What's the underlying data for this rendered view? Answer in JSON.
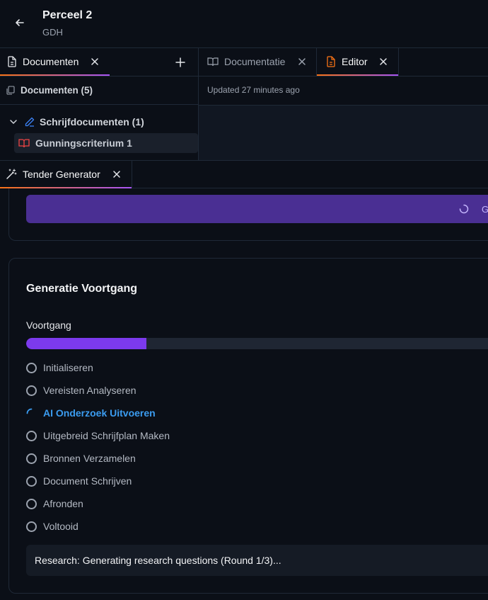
{
  "header": {
    "title": "Perceel 2",
    "subtitle": "GDH"
  },
  "tabs": {
    "documenten": "Documenten",
    "documentatie": "Documentatie",
    "editor": "Editor"
  },
  "documents": {
    "header": "Documenten (5)",
    "group": "Schrijfdocumenten (1)",
    "item": "Gunningscriterium 1"
  },
  "editor": {
    "updated": "Updated 27 minutes ago"
  },
  "generator": {
    "tab_label": "Tender Generator",
    "button_label": "G",
    "progress_title": "Generatie Voortgang",
    "progress_label": "Voortgang",
    "progress_fraction": 0.25,
    "steps": [
      {
        "label": "Initialiseren",
        "state": "pending"
      },
      {
        "label": "Vereisten Analyseren",
        "state": "pending"
      },
      {
        "label": "AI Onderzoek Uitvoeren",
        "state": "active"
      },
      {
        "label": "Uitgebreid Schrijfplan Maken",
        "state": "pending"
      },
      {
        "label": "Bronnen Verzamelen",
        "state": "pending"
      },
      {
        "label": "Document Schrijven",
        "state": "pending"
      },
      {
        "label": "Afronden",
        "state": "pending"
      },
      {
        "label": "Voltooid",
        "state": "pending"
      }
    ],
    "status": "Research: Generating research questions (Round 1/3)..."
  },
  "colors": {
    "accent_purple": "#7c3aed",
    "active_blue": "#3b9cf0",
    "tab_gradient_start": "#f97316",
    "tab_gradient_end": "#a855f7"
  }
}
